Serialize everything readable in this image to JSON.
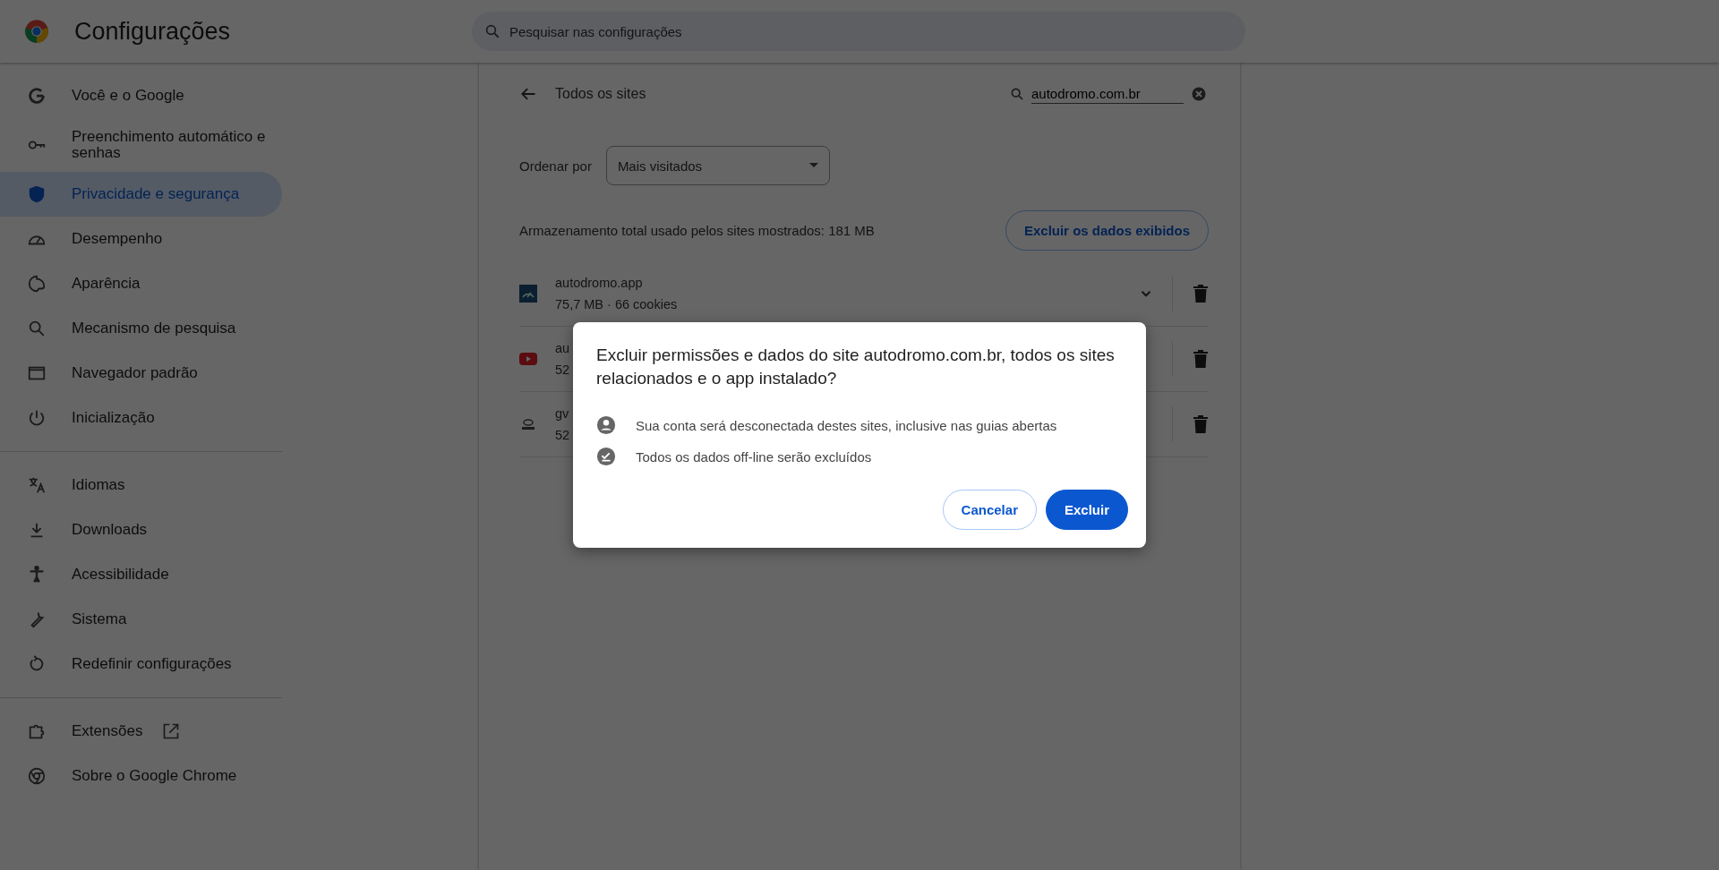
{
  "header": {
    "title": "Configurações",
    "search": {
      "placeholder": "Pesquisar nas configurações"
    }
  },
  "sidebar": {
    "groups": [
      {
        "items": [
          {
            "label": "Você e o Google",
            "selected": false
          },
          {
            "label": "Preenchimento automático e senhas",
            "selected": false
          },
          {
            "label": "Privacidade e segurança",
            "selected": true
          },
          {
            "label": "Desempenho",
            "selected": false
          },
          {
            "label": "Aparência",
            "selected": false
          },
          {
            "label": "Mecanismo de pesquisa",
            "selected": false
          },
          {
            "label": "Navegador padrão",
            "selected": false
          },
          {
            "label": "Inicialização",
            "selected": false
          }
        ]
      },
      {
        "items": [
          {
            "label": "Idiomas",
            "selected": false
          },
          {
            "label": "Downloads",
            "selected": false
          },
          {
            "label": "Acessibilidade",
            "selected": false
          },
          {
            "label": "Sistema",
            "selected": false
          },
          {
            "label": "Redefinir configurações",
            "selected": false
          }
        ]
      },
      {
        "items": [
          {
            "label": "Extensões",
            "selected": false,
            "external": true
          },
          {
            "label": "Sobre o Google Chrome",
            "selected": false
          }
        ]
      }
    ]
  },
  "content": {
    "title": "Todos os sites",
    "filter": {
      "value": "autodromo.com.br"
    },
    "sort": {
      "label": "Ordenar por",
      "value": "Mais visitados"
    },
    "storage": "Armazenamento total usado pelos sites mostrados: 181 MB",
    "clear_button": "Excluir os dados exibidos",
    "sites": [
      {
        "name": "autodromo.app",
        "detail": "75,7 MB · 66 cookies",
        "expandable": true
      },
      {
        "name": "au",
        "detail": "52",
        "expandable": false
      },
      {
        "name": "gv",
        "detail": "52",
        "expandable": false
      }
    ]
  },
  "dialog": {
    "title": "Excluir permissões e dados do site autodromo.com.br, todos os sites relacionados e o app instalado?",
    "notes": [
      "Sua conta será desconectada destes sites, inclusive nas guias abertas",
      "Todos os dados off-line serão excluídos"
    ],
    "buttons": [
      {
        "label": "Cancelar",
        "kind": "secondary"
      },
      {
        "label": "Excluir",
        "kind": "primary"
      }
    ]
  }
}
